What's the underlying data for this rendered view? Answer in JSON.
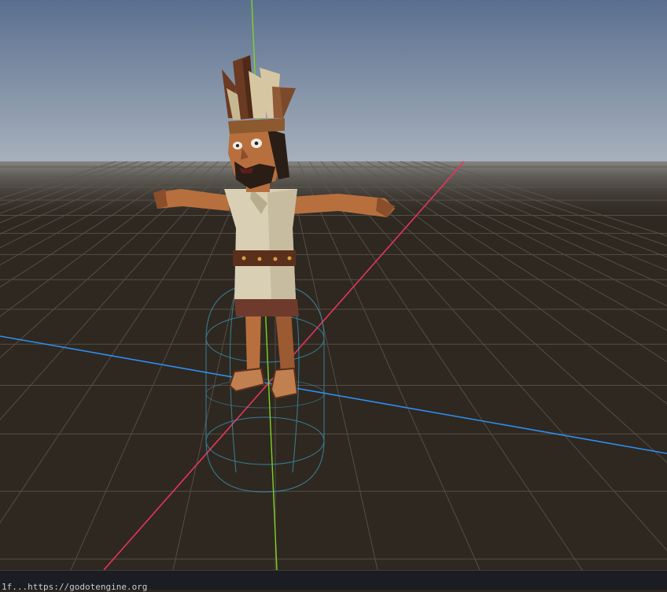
{
  "viewport": {
    "sky_top": "#5a6f8f",
    "sky_horizon": "#a9b2bd",
    "ground_color": "#2e2821",
    "grid_color": "#5e574f",
    "axis_x_color": "#e8345a",
    "axis_y_color": "#7ed321",
    "axis_z_color": "#2f8ef0",
    "collision_shape_color": "#3fa6c4"
  },
  "character": {
    "skin": "#b86f3e",
    "skin_dark": "#8a4e2a",
    "tunic": "#d9cfb4",
    "tunic_shade": "#b8ac8f",
    "belt": "#5a2f1c",
    "belt_studs": "#d6a13c",
    "skirt": "#6e3a2c",
    "beard": "#2a1d16",
    "headband": "#8c5a2e",
    "feather_dark": "#6b3a22",
    "feather_light": "#d6c7a2"
  },
  "status_bar": {
    "text": "1f...https://godotengine.org"
  }
}
